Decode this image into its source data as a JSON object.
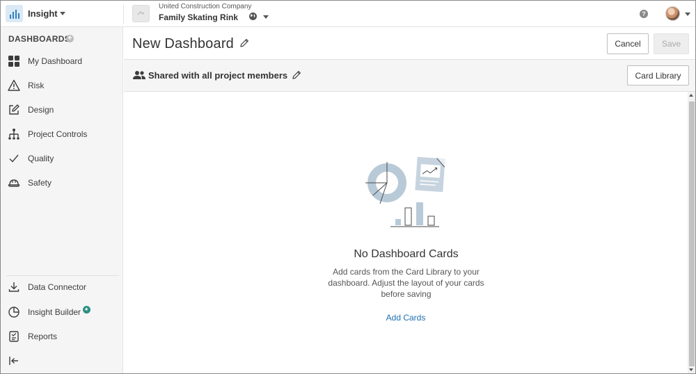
{
  "topbar": {
    "app_name": "Insight",
    "company": "United Construction Company",
    "project": "Family Skating Rink",
    "help_label": "?"
  },
  "sidebar": {
    "section_title": "DASHBOARDS",
    "add_label": "+",
    "items": [
      {
        "label": "My Dashboard",
        "icon": "grid-icon"
      },
      {
        "label": "Risk",
        "icon": "warning-icon"
      },
      {
        "label": "Design",
        "icon": "edit-icon"
      },
      {
        "label": "Project Controls",
        "icon": "hierarchy-icon"
      },
      {
        "label": "Quality",
        "icon": "check-icon"
      },
      {
        "label": "Safety",
        "icon": "hardhat-icon"
      }
    ],
    "bottom_items": [
      {
        "label": "Data Connector",
        "icon": "download-icon"
      },
      {
        "label": "Insight Builder",
        "icon": "pie-chart-icon",
        "badge": "star-badge"
      },
      {
        "label": "Reports",
        "icon": "report-icon"
      }
    ],
    "collapse_icon": "collapse-left-icon"
  },
  "header": {
    "title": "New Dashboard",
    "cancel_label": "Cancel",
    "save_label": "Save"
  },
  "share_bar": {
    "text": "Shared with all project members",
    "card_library_label": "Card Library"
  },
  "empty_state": {
    "title": "No Dashboard Cards",
    "description": "Add cards from the Card Library to your dashboard. Adjust the layout of your cards before saving",
    "action_label": "Add Cards"
  },
  "colors": {
    "accent": "#1f6fb2",
    "illustration": "#b8cad8",
    "badge": "#2b8f81"
  }
}
